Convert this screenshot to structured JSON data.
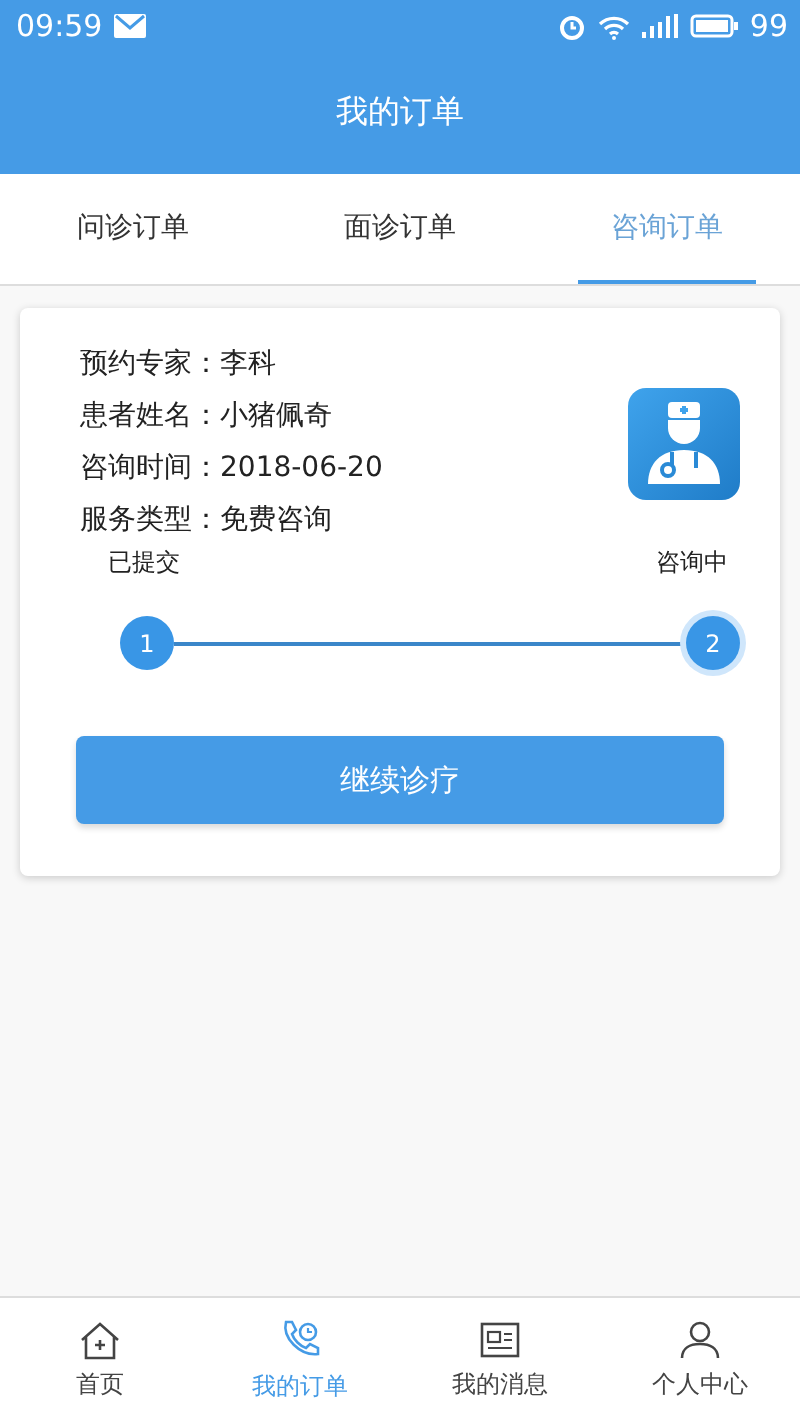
{
  "status_bar": {
    "time": "09:59",
    "battery": "99"
  },
  "header": {
    "title": "我的订单"
  },
  "tabs": [
    {
      "label": "问诊订单",
      "selected": false
    },
    {
      "label": "面诊订单",
      "selected": false
    },
    {
      "label": "咨询订单",
      "selected": true
    }
  ],
  "order": {
    "fields": [
      {
        "label": "预约专家：",
        "value": "李科"
      },
      {
        "label": "患者姓名：",
        "value": "小猪佩奇"
      },
      {
        "label": "咨询时间：",
        "value": "2018-06-20"
      },
      {
        "label": "服务类型：",
        "value": "免费咨询"
      }
    ],
    "steps": [
      {
        "label": "已提交",
        "number": "1",
        "current": false
      },
      {
        "label": "咨询中",
        "number": "2",
        "current": true
      }
    ],
    "button": "继续诊疗"
  },
  "bottom_nav": [
    {
      "kind": "home",
      "label": "首页",
      "selected": false
    },
    {
      "kind": "orders",
      "label": "我的订单",
      "selected": true
    },
    {
      "kind": "messages",
      "label": "我的消息",
      "selected": false
    },
    {
      "kind": "profile",
      "label": "个人中心",
      "selected": false
    }
  ]
}
